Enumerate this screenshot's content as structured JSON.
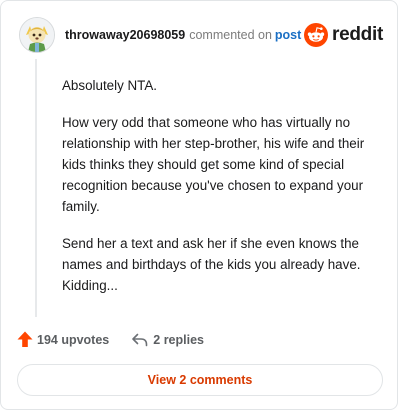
{
  "comment": {
    "username": "throwaway20698059",
    "action_text": "commented on",
    "post_link_label": "post",
    "avatar_icon": "cartoon-dog-avatar-icon"
  },
  "brand": {
    "name": "reddit",
    "logo_icon": "reddit-alien-logo-icon",
    "accent_color": "#ff4500"
  },
  "body": {
    "paragraphs": [
      "Absolutely NTA.",
      "How very odd that someone who has virtually no relationship with her step-brother, his wife and their kids thinks they should get some kind of special recognition because you've chosen to expand your family.",
      "Send her a text and ask her if she even knows the names and birthdays of the kids you already have. Kidding..."
    ]
  },
  "footer": {
    "upvotes_label": "194 upvotes",
    "upvote_icon": "upvote-arrow-icon",
    "replies_label": "2 replies",
    "reply_icon": "reply-arrow-icon"
  },
  "view_comments_label": "View 2 comments",
  "colors": {
    "username": "#1a1a1b",
    "post_link": "#1a6fc4",
    "upvote": "#ff4500",
    "view_button_text": "#d93a00"
  }
}
